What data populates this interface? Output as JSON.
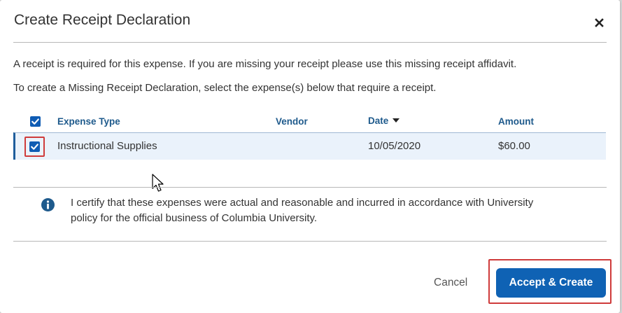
{
  "dialog": {
    "title": "Create Receipt Declaration",
    "close_icon": "close-icon",
    "intro_line1": "A receipt is required for this expense. If you are missing your receipt please use this missing receipt affidavit.",
    "intro_line2": "To create a Missing Receipt Declaration, select the expense(s) below that require a receipt."
  },
  "table": {
    "select_all_checked": true,
    "columns": {
      "expense_type": "Expense Type",
      "vendor": "Vendor",
      "date": "Date",
      "amount": "Amount"
    },
    "sort_column": "date",
    "sort_direction": "descending",
    "rows": [
      {
        "checked": true,
        "expense_type": "Instructional Supplies",
        "vendor": "",
        "date": "10/05/2020",
        "amount": "$60.00"
      }
    ]
  },
  "certification": {
    "icon": "info-icon",
    "text": "I certify that these expenses were actual and reasonable and incurred in accordance with University policy for the official business of Columbia University."
  },
  "footer": {
    "cancel_label": "Cancel",
    "accept_label": "Accept & Create"
  },
  "colors": {
    "primary": "#0f62b4",
    "header_text": "#1e5a8c",
    "row_highlight": "#eaf2fb",
    "annotation_red": "#cf3b3b"
  }
}
